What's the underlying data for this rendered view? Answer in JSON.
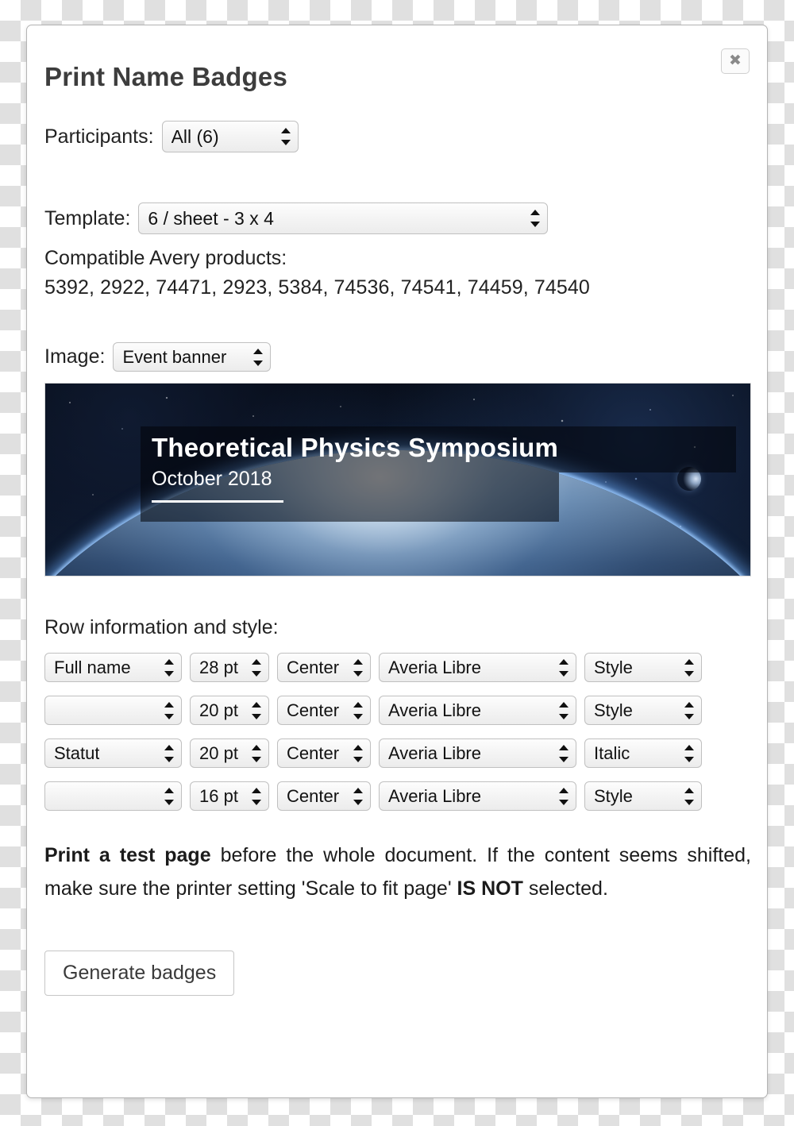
{
  "dialog": {
    "title": "Print Name Badges",
    "close_label": "✖"
  },
  "participants": {
    "label": "Participants:",
    "value": "All (6)"
  },
  "template": {
    "label": "Template:",
    "value": "6 / sheet - 3 x 4",
    "avery_title": "Compatible Avery products:",
    "avery_products": "5392, 2922, 74471, 2923, 5384, 74536, 74541, 74459, 74540"
  },
  "image": {
    "label": "Image:",
    "value": "Event banner",
    "banner": {
      "title": "Theoretical Physics Symposium",
      "subtitle": "October 2018"
    }
  },
  "rows_section": {
    "title": "Row information and style:",
    "rows": [
      {
        "field": "Full name",
        "size": "28 pt",
        "align": "Center",
        "font": "Averia Libre",
        "style": "Style"
      },
      {
        "field": "",
        "size": "20 pt",
        "align": "Center",
        "font": "Averia Libre",
        "style": "Style"
      },
      {
        "field": "Statut",
        "size": "20 pt",
        "align": "Center",
        "font": "Averia Libre",
        "style": "Italic"
      },
      {
        "field": "",
        "size": "16 pt",
        "align": "Center",
        "font": "Averia Libre",
        "style": "Style"
      }
    ]
  },
  "note": {
    "bold_lead": "Print a test page",
    "body_1": " before the whole document. If the content seems shifted, make sure the printer setting 'Scale to fit page' ",
    "bold_emphasis": "IS NOT",
    "body_2": " selected."
  },
  "actions": {
    "generate_label": "Generate badges"
  },
  "colors": {
    "text": "#222222",
    "title": "#3d3d3d",
    "border": "#c0c0c0"
  }
}
